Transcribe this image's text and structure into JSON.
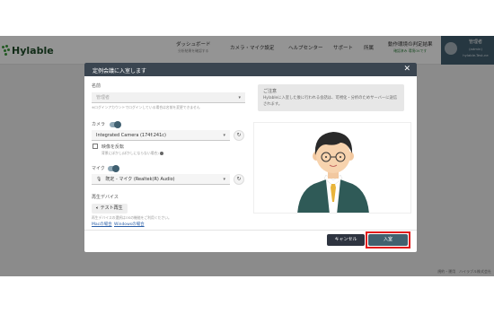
{
  "app": {
    "logo": "Hylable",
    "nav": [
      {
        "label": "ダッシュボード",
        "sub": "分析結果を確認する"
      },
      {
        "label": "カメラ・マイク設定",
        "sub": ""
      },
      {
        "label": "ヘルプセンター",
        "sub": ""
      },
      {
        "label": "サポート",
        "sub": ""
      },
      {
        "label": "所属",
        "sub": ""
      },
      {
        "label": "動作環境の判定結果",
        "sub": "確認済み 環境OKです"
      }
    ],
    "user": {
      "name": "管理者",
      "role": "(admin)",
      "org": "hylable-Test-ne"
    },
    "footer": "規約・運用　ハイラブル株式会社"
  },
  "dialog": {
    "title": "定例会議に入室します",
    "close_icon": "close-icon",
    "name": {
      "label": "名前",
      "value": "管理者",
      "hint": "※ログインアカウントでログインしている場合は名前を変更できません"
    },
    "camera": {
      "label": "カメラ",
      "toggle_on": true,
      "value": "Integrated Camera (174f:241c)",
      "mirror_label": "映像を反転",
      "mirror_hint": "背景にぼかし(ぼかしにならない場合)",
      "mirror_checked": false
    },
    "mic": {
      "label": "マイク",
      "toggle_on": true,
      "value": "既定 - マイク (Realtek(R) Audio)"
    },
    "playback": {
      "label": "再生デバイス",
      "test_button": "テスト再生",
      "hint": "再生デバイスの選択はOSの機能をご利用ください。",
      "mac_link": "Macの場合",
      "windows_link": "Windowsの場合"
    },
    "notice": {
      "title": "ご注意",
      "body": "Hylableに入室した後に行われる会話は、可視化・分析のためサーバーに送信されます。"
    },
    "cancel_label": "キャンセル",
    "enter_label": "入室"
  },
  "colors": {
    "header": "#3a4550",
    "primary_button": "#42616f",
    "cancel_button": "#2e3440",
    "highlight": "#e21b1b",
    "toggle": "#3f5f70"
  }
}
